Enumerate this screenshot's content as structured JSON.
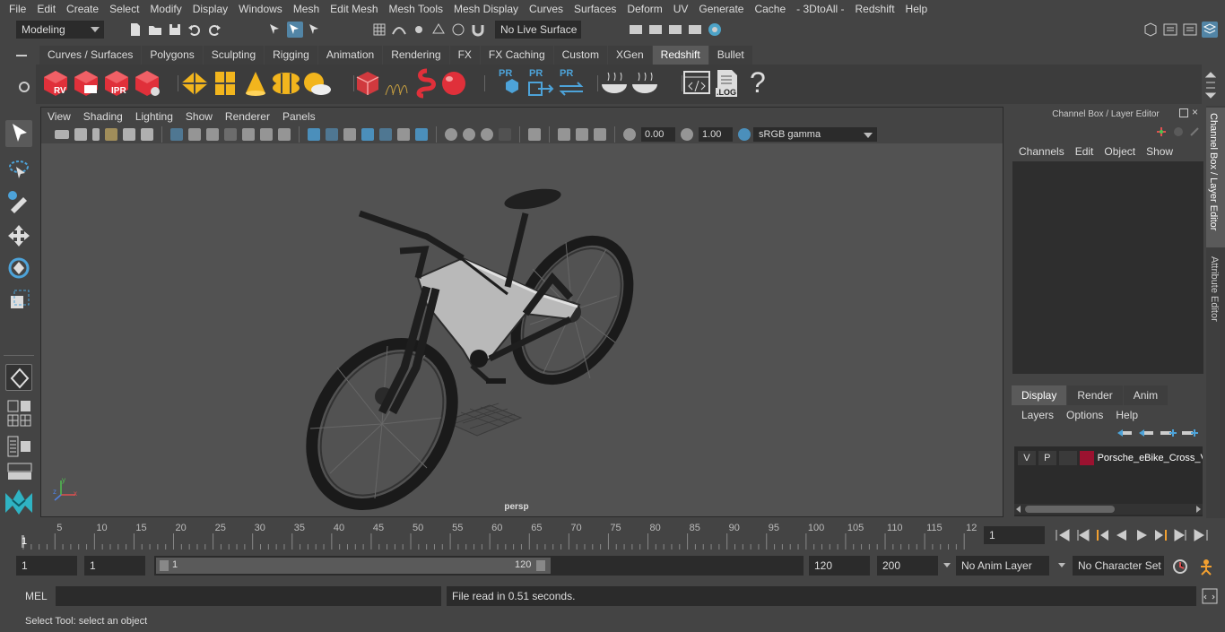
{
  "menubar": {
    "items": [
      "File",
      "Edit",
      "Create",
      "Select",
      "Modify",
      "Display",
      "Windows",
      "Mesh",
      "Edit Mesh",
      "Mesh Tools",
      "Mesh Display",
      "Curves",
      "Surfaces",
      "Deform",
      "UV",
      "Generate",
      "Cache",
      "- 3DtoAll -",
      "Redshift",
      "Help"
    ]
  },
  "statusline": {
    "workspace": "Modeling",
    "live_surface": "No Live Surface"
  },
  "shelf": {
    "tabs": [
      "Curves / Surfaces",
      "Polygons",
      "Sculpting",
      "Rigging",
      "Animation",
      "Rendering",
      "FX",
      "FX Caching",
      "Custom",
      "XGen",
      "Redshift",
      "Bullet"
    ],
    "active_tab": "Redshift",
    "icon_labels": {
      "rv": "RV",
      "ipr": "IPR",
      "pr": "PR",
      "log": ".LOG",
      "help": "?"
    }
  },
  "viewport": {
    "menu": [
      "View",
      "Shading",
      "Lighting",
      "Show",
      "Renderer",
      "Panels"
    ],
    "exposure": "0.00",
    "gamma": "1.00",
    "color_space": "sRGB gamma",
    "camera_label": "persp",
    "axis_labels": {
      "x": "x",
      "y": "y",
      "z": "z"
    }
  },
  "channelbox": {
    "title": "Channel Box / Layer Editor",
    "menu": [
      "Channels",
      "Edit",
      "Object",
      "Show"
    ],
    "layer_tabs": [
      "Display",
      "Render",
      "Anim"
    ],
    "active_layer_tab": "Display",
    "layer_menu": [
      "Layers",
      "Options",
      "Help"
    ],
    "layers": [
      {
        "v": "V",
        "p": "P",
        "name": "Porsche_eBike_Cross_V",
        "color": "#9b1230"
      }
    ]
  },
  "side_tabs": [
    "Channel Box / Layer Editor",
    "Attribute Editor"
  ],
  "timeline": {
    "ticks": [
      "5",
      "10",
      "15",
      "20",
      "25",
      "30",
      "35",
      "40",
      "45",
      "50",
      "55",
      "60",
      "65",
      "70",
      "75",
      "80",
      "85",
      "90",
      "95",
      "100",
      "105",
      "110",
      "115",
      "12"
    ],
    "current_frame_marker": "1",
    "current_frame": "1"
  },
  "range": {
    "start": "1",
    "playback_start": "1",
    "slider_start": "1",
    "slider_end": "120",
    "playback_end": "120",
    "end": "200",
    "anim_layer": "No Anim Layer",
    "character_set": "No Character Set"
  },
  "cmdline": {
    "language": "MEL",
    "result": "File read in  0.51 seconds."
  },
  "helpline": {
    "text": "Select Tool: select an object"
  },
  "colors": {
    "bg": "#444444",
    "field": "#2b2b2b",
    "accent": "#5285a6",
    "redshift_red": "#e0303a",
    "viewport_bg": "#525252"
  }
}
